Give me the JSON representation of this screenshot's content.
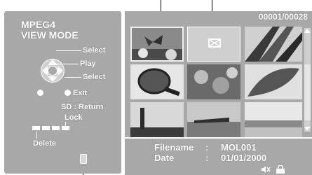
{
  "mode": {
    "line1": "MPEG4",
    "line2": "VIEW MODE"
  },
  "controls": {
    "select_top": "Select",
    "play": "Play",
    "select_bottom": "Select",
    "exit": "Exit",
    "sd_return": "SD : Return",
    "lock": "Lock",
    "delete": "Delete"
  },
  "counter": "00001/00028",
  "info": {
    "filename_label": "Filename",
    "filename_value": "MOL001",
    "date_label": "Date",
    "date_value": "01/01/2000",
    "separator": ":"
  },
  "icons": {
    "speaker_muted": "speaker-muted-icon",
    "lock_status": "lock-icon",
    "broken_image": "envelope-icon"
  },
  "thumbnails": [
    {
      "subject": "butterfly on flowers",
      "selected": true
    },
    {
      "subject": "broken image placeholder",
      "selected": false
    },
    {
      "subject": "palm frond",
      "selected": false
    },
    {
      "subject": "magnifying glass",
      "selected": false
    },
    {
      "subject": "fish in tidepool",
      "selected": false
    },
    {
      "subject": "leaf close-up",
      "selected": false
    },
    {
      "subject": "statue",
      "selected": false
    },
    {
      "subject": "dock and water",
      "selected": false
    },
    {
      "subject": "beach",
      "selected": false
    }
  ],
  "colors": {
    "panel": "#a8a8a8",
    "text": "#ffffff",
    "background": "#ffffff"
  }
}
